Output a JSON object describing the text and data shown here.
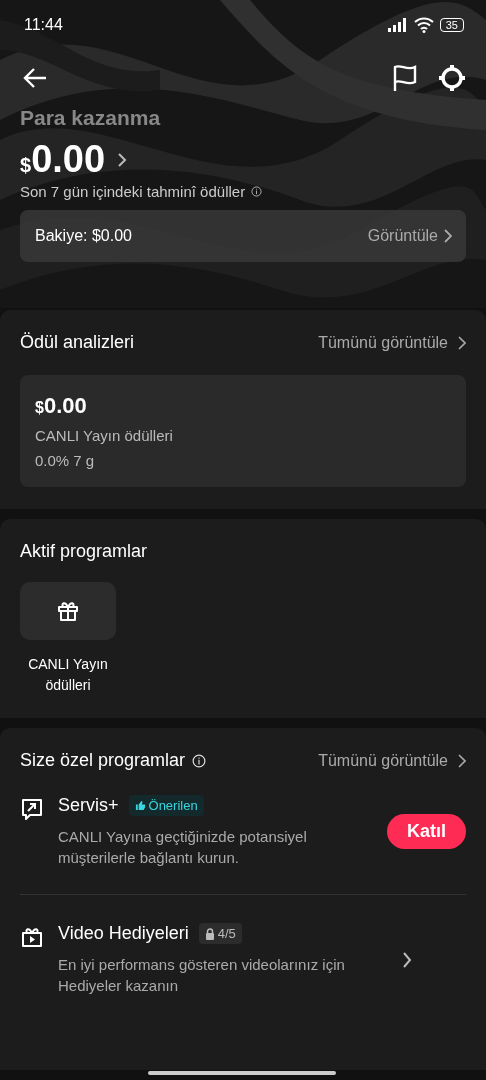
{
  "status_bar": {
    "time": "11:44",
    "battery": "35"
  },
  "header": {
    "title": "Para kazanma",
    "currency": "$",
    "amount": "0.00",
    "subtitle": "Son 7 gün içindeki tahminî ödüller",
    "balance": "Bakiye: $0.00",
    "balance_link": "Görüntüle"
  },
  "reward_analysis": {
    "title": "Ödül analizleri",
    "link": "Tümünü görüntüle",
    "card": {
      "currency": "$",
      "amount": "0.00",
      "label": "CANLI Yayın ödülleri",
      "change": "0.0% 7 g"
    }
  },
  "active_programs": {
    "title": "Aktif programlar",
    "items": [
      {
        "label": "CANLI Yayın ödülleri"
      }
    ]
  },
  "special_programs": {
    "title": "Size özel programlar",
    "link": "Tümünü görüntüle",
    "items": [
      {
        "kind": "join",
        "name": "Servis+",
        "badge": {
          "kind": "recommended",
          "text": "Önerilen"
        },
        "description": "CANLI Yayına geçtiğinizde potansiyel müşterilerle bağlantı kurun.",
        "button": "Katıl"
      },
      {
        "kind": "link",
        "name": "Video Hediyeleri",
        "badge": {
          "kind": "locked",
          "text": "4/5"
        },
        "description": "En iyi performans gösteren videolarınız için Hediyeler kazanın"
      }
    ]
  }
}
